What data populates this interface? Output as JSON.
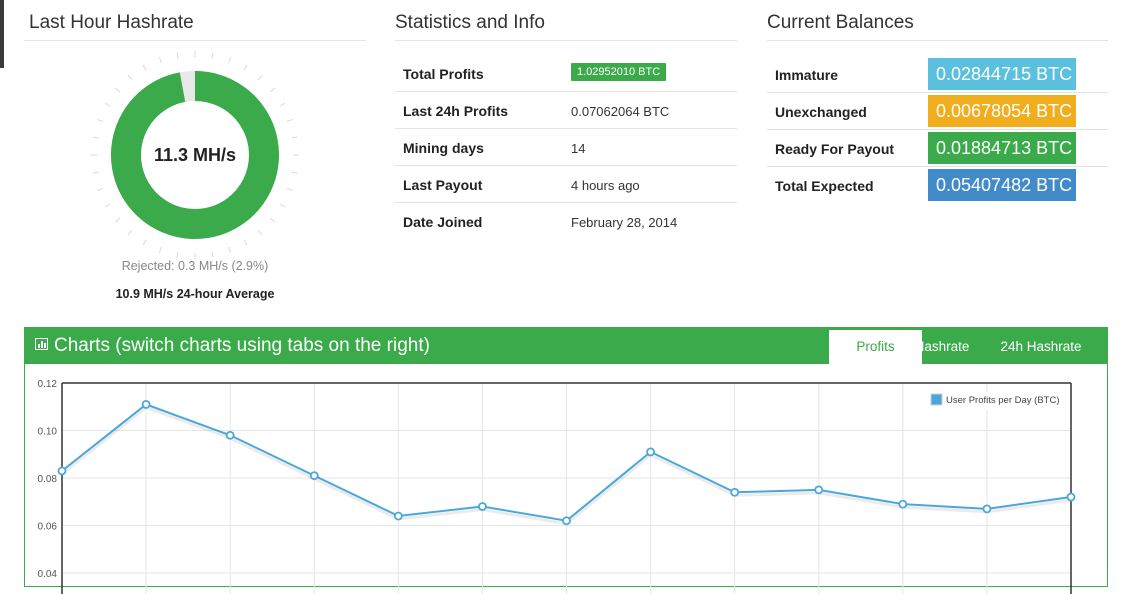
{
  "hashrate": {
    "title": "Last Hour Hashrate",
    "value": "11.3 MH/s",
    "gauge_fill": 0.971,
    "rejected": "Rejected: 0.3 MH/s (2.9%)",
    "average": "10.9 MH/s 24-hour Average"
  },
  "stats": {
    "title": "Statistics and Info",
    "rows": [
      {
        "label": "Total Profits",
        "value": "1.02952010 BTC"
      },
      {
        "label": "Last 24h Profits",
        "value": "0.07062064 BTC"
      },
      {
        "label": "Mining days",
        "value": "14"
      },
      {
        "label": "Last Payout",
        "value": "4 hours ago"
      },
      {
        "label": "Date Joined",
        "value": "February 28, 2014"
      }
    ]
  },
  "balances": {
    "title": "Current Balances",
    "rows": [
      {
        "label": "Immature",
        "value": "0.02844715 BTC",
        "color": "#5bc0de"
      },
      {
        "label": "Unexchanged",
        "value": "0.00678054 BTC",
        "color": "#f0ad1e"
      },
      {
        "label": "Ready For Payout",
        "value": "0.01884713 BTC",
        "color": "#3aaa4a"
      },
      {
        "label": "Total Expected",
        "value": "0.05407482 BTC",
        "color": "#428bca"
      }
    ]
  },
  "charts": {
    "title": "Charts (switch charts using tabs on the right)",
    "title_icon": "bar-chart-icon",
    "tabs": [
      {
        "label": "Profits",
        "active": true
      },
      {
        "label": "Hashrate",
        "active": false
      },
      {
        "label": "24h Hashrate",
        "active": false
      }
    ]
  },
  "colors": {
    "green": "#3aaa4a",
    "line": "#4aa8d8",
    "gauge_track": "#e8e8e8"
  },
  "chart_data": {
    "type": "line",
    "series": [
      {
        "name": "User Profits per Day (BTC)",
        "values": [
          0.083,
          0.111,
          0.098,
          0.081,
          0.064,
          0.068,
          0.062,
          0.091,
          0.074,
          0.075,
          0.069,
          0.067,
          0.072
        ]
      }
    ],
    "y_ticks": [
      "0.12",
      "0.10",
      "0.08",
      "0.06",
      "0.04"
    ],
    "ylim": [
      0.04,
      0.12
    ],
    "legend": "top-right",
    "grid": true
  }
}
